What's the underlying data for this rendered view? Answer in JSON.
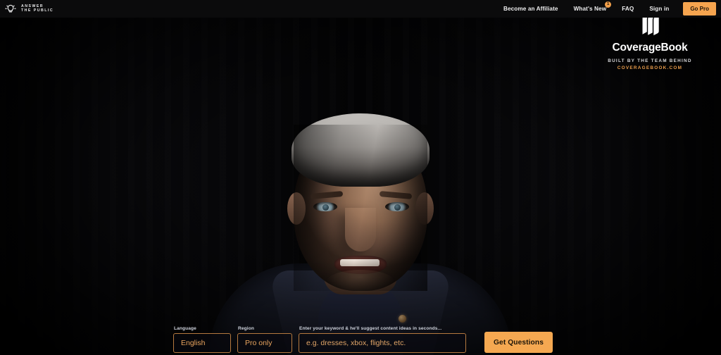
{
  "header": {
    "logo": {
      "icon": "lightbulb-icon",
      "line1": "ANSWER",
      "line2": "THE PUBLIC"
    },
    "nav": [
      {
        "label": "Become an Affiliate",
        "name": "nav-become-an-affiliate",
        "badge": null
      },
      {
        "label": "What's New",
        "name": "nav-whats-new",
        "badge": "1"
      },
      {
        "label": "FAQ",
        "name": "nav-faq",
        "badge": null
      },
      {
        "label": "Sign in",
        "name": "nav-sign-in",
        "badge": null
      }
    ],
    "cta": {
      "label": "Go Pro"
    }
  },
  "sponsor": {
    "icon": "books-icon",
    "name": "CoverageBook",
    "tagline": "BUILT BY THE TEAM BEHIND",
    "url": "COVERAGEBOOK.COM"
  },
  "hero": {
    "media": "background-video-presenter"
  },
  "search": {
    "language": {
      "label": "Language",
      "value": "English"
    },
    "region": {
      "label": "Region",
      "value": "Pro only"
    },
    "keyword": {
      "label": "Enter your keyword & he'll suggest content ideas in seconds...",
      "placeholder": "e.g. dresses, xbox, flights, etc.",
      "value": ""
    },
    "submit_label": "Get Questions"
  },
  "colors": {
    "accent": "#f5a851",
    "accent_text": "#e9a45e",
    "border": "#b5793f",
    "bar": "#0b0b0c",
    "stage": "#000000"
  }
}
